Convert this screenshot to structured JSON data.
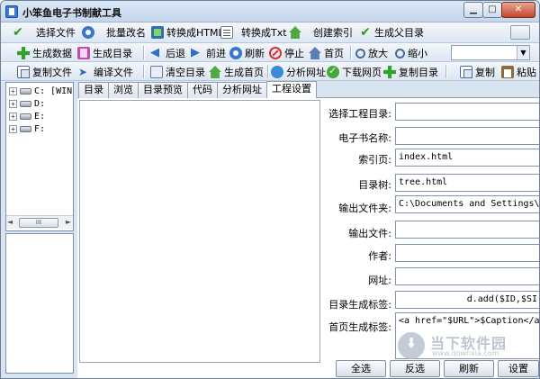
{
  "window": {
    "title": "小笨鱼电子书制献工具"
  },
  "controls": {
    "minimize": "▁",
    "maximize": "□",
    "close": "✕"
  },
  "toolbar1": {
    "select_file": "选择文件",
    "batch_rename": "批量改名",
    "to_html": "转换成HTML",
    "to_txt": "转换成Txt",
    "create_index": "创建索引",
    "generate_parent_dir": "生成父目录"
  },
  "toolbar2": {
    "generate_data": "生成数据",
    "generate_toc": "生成目录",
    "back": "后退",
    "forward": "前进",
    "refresh": "刷新",
    "stop": "停止",
    "home": "首页",
    "zoom_in": "放大",
    "zoom_out": "缩小",
    "combo_value": ""
  },
  "toolbar3": {
    "copy_file": "复制文件",
    "compile_file": "编译文件",
    "clear_toc": "清空目录",
    "generate_homepage": "生成首页",
    "analyze_url": "分析网址",
    "download_page": "下载网页",
    "copy_toc": "复制目录",
    "copy": "复制",
    "paste": "粘贴"
  },
  "tree": {
    "drives": [
      "C: [WIN",
      "D:",
      "E:",
      "F:"
    ],
    "expander": "+",
    "scroll_left": "◄",
    "scroll_thumb": "III",
    "scroll_right": "►"
  },
  "tabs": [
    "目录",
    "浏览",
    "目录预览",
    "代码",
    "分析网址",
    "工程设置"
  ],
  "form": {
    "project_dir": {
      "label": "选择工程目录:",
      "value": ""
    },
    "ebook_name": {
      "label": "电子书名称:",
      "value": ""
    },
    "index_page": {
      "label": "索引页:",
      "value": "index.html"
    },
    "toc_tree": {
      "label": "目录树:",
      "value": "tree.html"
    },
    "output_folder": {
      "label": "输出文件夹:",
      "value": "C:\\Documents and Settings\\Adm"
    },
    "output_file": {
      "label": "输出文件:",
      "value": ""
    },
    "author": {
      "label": "作者:",
      "value": ""
    },
    "website": {
      "label": "网址:",
      "value": ""
    },
    "toc_tag": {
      "label": "目录生成标签:",
      "value": "d.add($ID,$SI"
    },
    "homepage_tag": {
      "label": "首页生成标签:",
      "value": "<a href=\"$URL\">$Caption</a></"
    }
  },
  "buttons": {
    "select_all": "全选",
    "invert": "反选",
    "refresh": "刷新",
    "settings": "设置"
  },
  "watermark": {
    "text": "当下软件园",
    "sub": "www.downxia.com"
  }
}
